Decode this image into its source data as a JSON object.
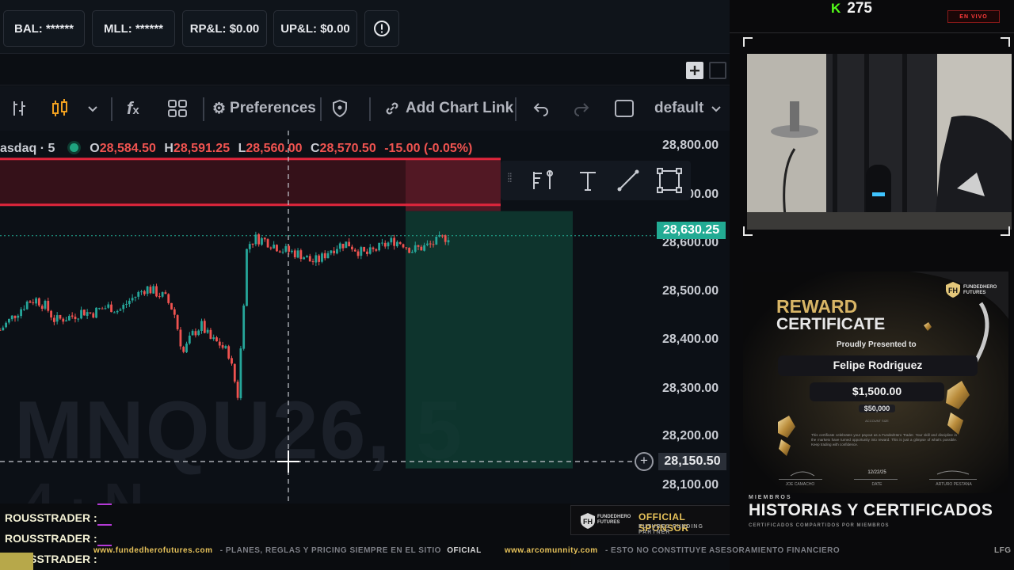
{
  "account_bar": {
    "balance_label": "BAL: ******",
    "mll_label": "MLL: ******",
    "rpl_label": "RP&L: $0.00",
    "upl_label": "UP&L: $0.00"
  },
  "toolbar": {
    "preferences_label": "Preferences",
    "add_chart_link_label": "Add Chart Link",
    "layout_label": "default"
  },
  "chart": {
    "legend_symbol": "asdaq · 5",
    "open_label": "O",
    "open_value": "28,584.50",
    "high_label": "H",
    "high_value": "28,591.25",
    "low_label": "L",
    "low_value": "28,560.00",
    "close_label": "C",
    "close_value": "28,570.50",
    "change": "-15.00 (-0.05%)",
    "watermark": "MNQU26, 5",
    "price_axis": [
      "28,800.00",
      "28,700.00",
      "28,600.00",
      "28,500.00",
      "28,400.00",
      "28,300.00",
      "28,200.00",
      "28,100.00"
    ],
    "last_price": "28,630.25",
    "crosshair_price": "28,150.50",
    "colors": {
      "up": "#26a69a",
      "down": "#ef5350",
      "last": "#22ab94",
      "stop": "#e0263c"
    }
  },
  "chart_data": {
    "type": "candlestick",
    "y_range": [
      28100,
      28820
    ],
    "price_levels": {
      "stop_line": 28770,
      "last_price": 28630.25,
      "crosshair": 28150.5
    },
    "trend": [
      28430,
      28450,
      28470,
      28490,
      28495,
      28480,
      28450,
      28455,
      28460,
      28470,
      28465,
      28475,
      28480,
      28470,
      28490,
      28505,
      28520,
      28510,
      28500,
      28470,
      28380,
      28420,
      28440,
      28410,
      28400,
      28380,
      28290,
      28610,
      28625,
      28620,
      28610,
      28600,
      28595,
      28590,
      28575,
      28580,
      28600,
      28610,
      28615,
      28600,
      28590,
      28600,
      28610,
      28620,
      28615,
      28600,
      28605,
      28610,
      28620,
      28630
    ]
  },
  "stream": {
    "viewer_count": "275",
    "live_badge": "EN VIVO",
    "chat": [
      {
        "name": "ROUSSTRADER :"
      },
      {
        "name": "ROUSSTRADER :"
      },
      {
        "name": "ROUSSTRADER :"
      }
    ],
    "sponsor_brand": "FUNDEDHERO FUTURES",
    "sponsor_title": "OFFICIAL SPONSOR",
    "sponsor_sub": "FUTURES FUNDING PARTNER",
    "ticker_site1": "www.fundedherofutures.com",
    "ticker_text1": "-  PLANES, REGLAS Y PRICING SIEMPRE EN EL SITIO",
    "ticker_oficial": "OFICIAL",
    "ticker_site2": "www.arcomunnity.com",
    "ticker_text2": "-  ESTO NO CONSTITUYE ASESORAMIENTO FINANCIERO",
    "ticker_end": "LFG",
    "section_kicker": "MIEMBROS",
    "section_title": "HISTORIAS Y CERTIFICADOS",
    "section_sub": "CERTIFICADOS COMPARTIDOS POR MIEMBROS"
  },
  "certificate": {
    "brand": "FUNDEDHERO FUTURES",
    "title_line1": "REWARD",
    "title_line2": "CERTIFICATE",
    "presented": "Proudly Presented to",
    "name": "Felipe Rodriguez",
    "amount": "$1,500.00",
    "account_size": "$50,000",
    "account_size_label": "ACCOUNT SIZE",
    "body": "This certificate celebrates your payout as a FundedHero Trader. Your skill and discipline in the markets have turned opportunity into reward. This is just a glimpse of what's possible. Keep trading with confidence.",
    "date": "12/22/25",
    "date_label": "DATE",
    "signer_left": "JOE CAMACHO",
    "signer_right": "ARTURO PESTANA"
  }
}
